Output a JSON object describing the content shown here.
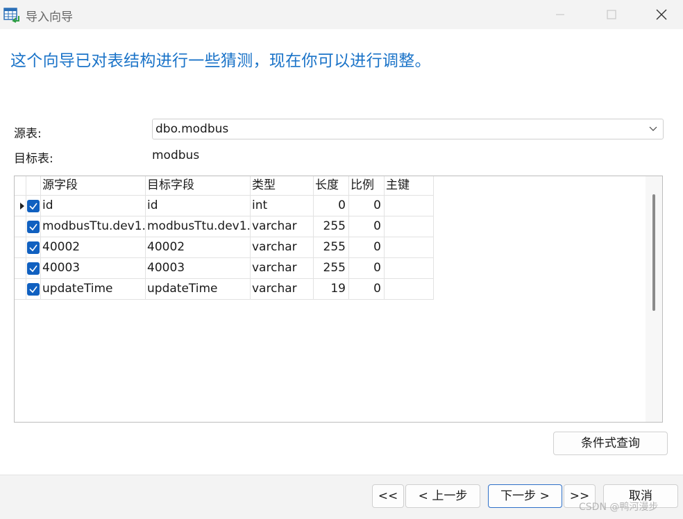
{
  "window": {
    "title": "导入向导",
    "icon": "table-import-icon",
    "controls": [
      "minimize-icon",
      "maximize-icon",
      "close-icon"
    ]
  },
  "headline": "这个向导已对表结构进行一些猜测，现在你可以进行调整。",
  "source_table": {
    "label": "源表:",
    "value": "dbo.modbus"
  },
  "target_table": {
    "label": "目标表:",
    "value": "modbus"
  },
  "grid": {
    "columns": [
      "源字段",
      "目标字段",
      "类型",
      "长度",
      "比例",
      "主键"
    ],
    "rows": [
      {
        "checked": true,
        "source": "id",
        "target": "id",
        "type": "int",
        "length": "0",
        "scale": "0",
        "pk": ""
      },
      {
        "checked": true,
        "source": "modbusTtu.dev1.",
        "target": "modbusTtu.dev1.",
        "type": "varchar",
        "length": "255",
        "scale": "0",
        "pk": ""
      },
      {
        "checked": true,
        "source": "40002",
        "target": "40002",
        "type": "varchar",
        "length": "255",
        "scale": "0",
        "pk": ""
      },
      {
        "checked": true,
        "source": "40003",
        "target": "40003",
        "type": "varchar",
        "length": "255",
        "scale": "0",
        "pk": ""
      },
      {
        "checked": true,
        "source": "updateTime",
        "target": "updateTime",
        "type": "varchar",
        "length": "19",
        "scale": "0",
        "pk": ""
      }
    ]
  },
  "buttons": {
    "condition_query": "条件式查询",
    "first": "<<",
    "back": "< 上一步",
    "next": "下一步 >",
    "last": ">>",
    "cancel": "取消"
  },
  "watermark": "CSDN @鸭河漫步",
  "colors": {
    "accent": "#1a73c8",
    "checkbox": "#1060c0",
    "primary_border": "#2d6fc8"
  }
}
